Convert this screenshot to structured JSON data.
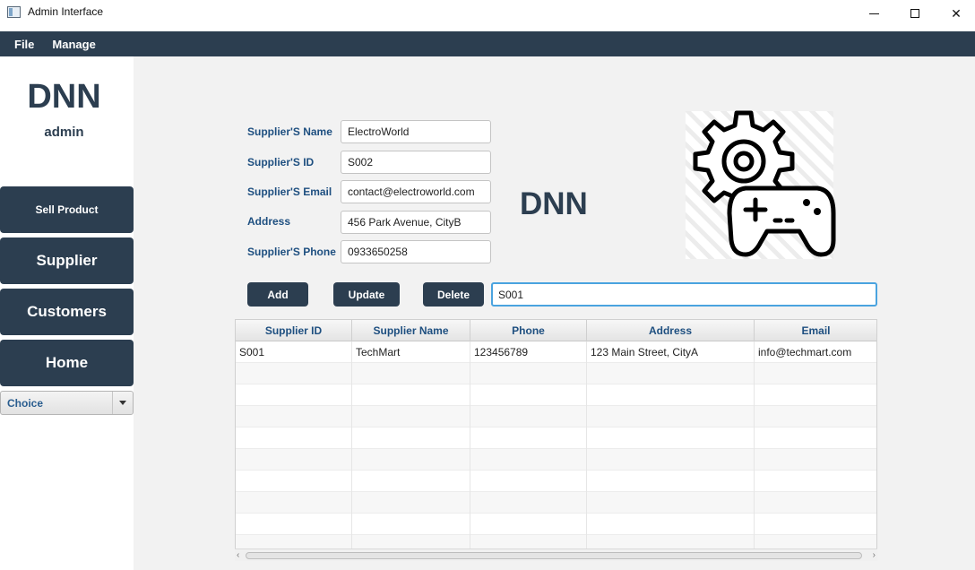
{
  "window": {
    "title": "Admin Interface"
  },
  "menu": {
    "items": [
      "File",
      "Manage"
    ]
  },
  "sidebar": {
    "brand": "DNN",
    "user": "admin",
    "nav": {
      "sell": "Sell Product",
      "supplier": "Supplier",
      "customers": "Customers",
      "home": "Home"
    },
    "choice": {
      "selected": "Choice"
    }
  },
  "form": {
    "name_label": "Supplier'S Name",
    "name_value": "ElectroWorld",
    "id_label": "Supplier'S ID",
    "id_value": "S002",
    "email_label": "Supplier'S Email",
    "email_value": "contact@electroworld.com",
    "address_label": "Address",
    "address_value": "456 Park Avenue, CityB",
    "phone_label": "Supplier'S Phone",
    "phone_value": "0933650258"
  },
  "center_brand": "DNN",
  "logo": {
    "icon": "gear-gamepad-icon"
  },
  "actions": {
    "add": "Add",
    "update": "Update",
    "delete": "Delete",
    "search_value": "S001"
  },
  "table": {
    "columns": [
      "Supplier ID",
      "Supplier Name",
      "Phone",
      "Address",
      "Email"
    ],
    "rows": [
      [
        "S001",
        "TechMart",
        "123456789",
        "123 Main Street, CityA",
        "info@techmart.com"
      ]
    ]
  },
  "colors": {
    "primary": "#2c3e50",
    "label": "#1e4f80",
    "focus": "#4aa3df"
  }
}
